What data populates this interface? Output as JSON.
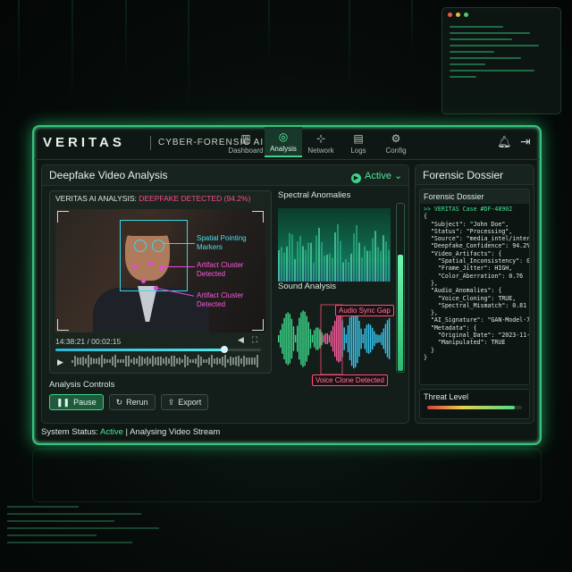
{
  "app": {
    "logo": "VERITAS",
    "subtitle": "CYBER-FORENSIC AI"
  },
  "nav": [
    {
      "label": "Dashboard",
      "icon": "bar-chart-icon"
    },
    {
      "label": "Analysis",
      "icon": "radar-icon",
      "active": true
    },
    {
      "label": "Network",
      "icon": "network-icon"
    },
    {
      "label": "Logs",
      "icon": "document-icon"
    },
    {
      "label": "Config",
      "icon": "gear-icon"
    }
  ],
  "panel": {
    "title": "Deepfake Video Analysis",
    "status": "Active"
  },
  "video": {
    "header_prefix": "VERITAS AI ANALYSIS: ",
    "header_alert": "DEEPFAKE DETECTED (94.2%)",
    "annotations": {
      "spatial_1": "Spatial Pointing",
      "spatial_2": "Markers",
      "artifact1_1": "Artifact Cluster",
      "artifact1_2": "Detected",
      "artifact2_1": "Artifact Cluster",
      "artifact2_2": "Detected"
    },
    "time": "14:38:21 / 00:02:15",
    "progress": 0.82
  },
  "spectral": {
    "title": "Spectral Anomalies"
  },
  "sound": {
    "title": "Sound Analysis",
    "tag_sync": "Audio Sync Gap",
    "tag_clone": "Voice Clone Detected"
  },
  "confidence_level": 0.7,
  "controls": {
    "title": "Analysis Controls",
    "pause": "Pause",
    "rerun": "Rerun",
    "export": "Export"
  },
  "status": {
    "label": "System Status: ",
    "state": "Active",
    "detail": " | Analysing Video Stream"
  },
  "dossier": {
    "panel_title": "Forensic Dossier",
    "card_title": "Forensic Dossier",
    "case": ">> VERITAS Case #DF-48902",
    "json": "{\n  \"Subject\": \"John Doe\",\n  \"Status\": \"Processing\",\n  \"Source\": \"media_intel/intercept\",\n  \"Deepfake_Confidence\": 94.2%,\n  \"Video_Artifacts\": {\n    \"Spatial_Inconsistency\": 0.88,\n    \"Frame_Jitter\": HIGH,\n    \"Color_Aberration\": 0.76\n  },\n  \"Audio_Anomalies\": {\n    \"Voice_Cloning\": TRUE,\n    \"Spectral_Mismatch\": 0.81\n  },\n  \"AI_Signature\": \"GAN-Model-7a\",\n  \"Metadata\": {\n    \"Original_Date\": \"2023-11-05\",\n    \"Manipulated\": TRUE\n  }\n}"
  },
  "threat": {
    "label": "Threat Level",
    "level": 0.92
  },
  "colors": {
    "accent": "#3fd18a",
    "alert": "#ff4b8b",
    "cyan": "#39d7e8"
  }
}
